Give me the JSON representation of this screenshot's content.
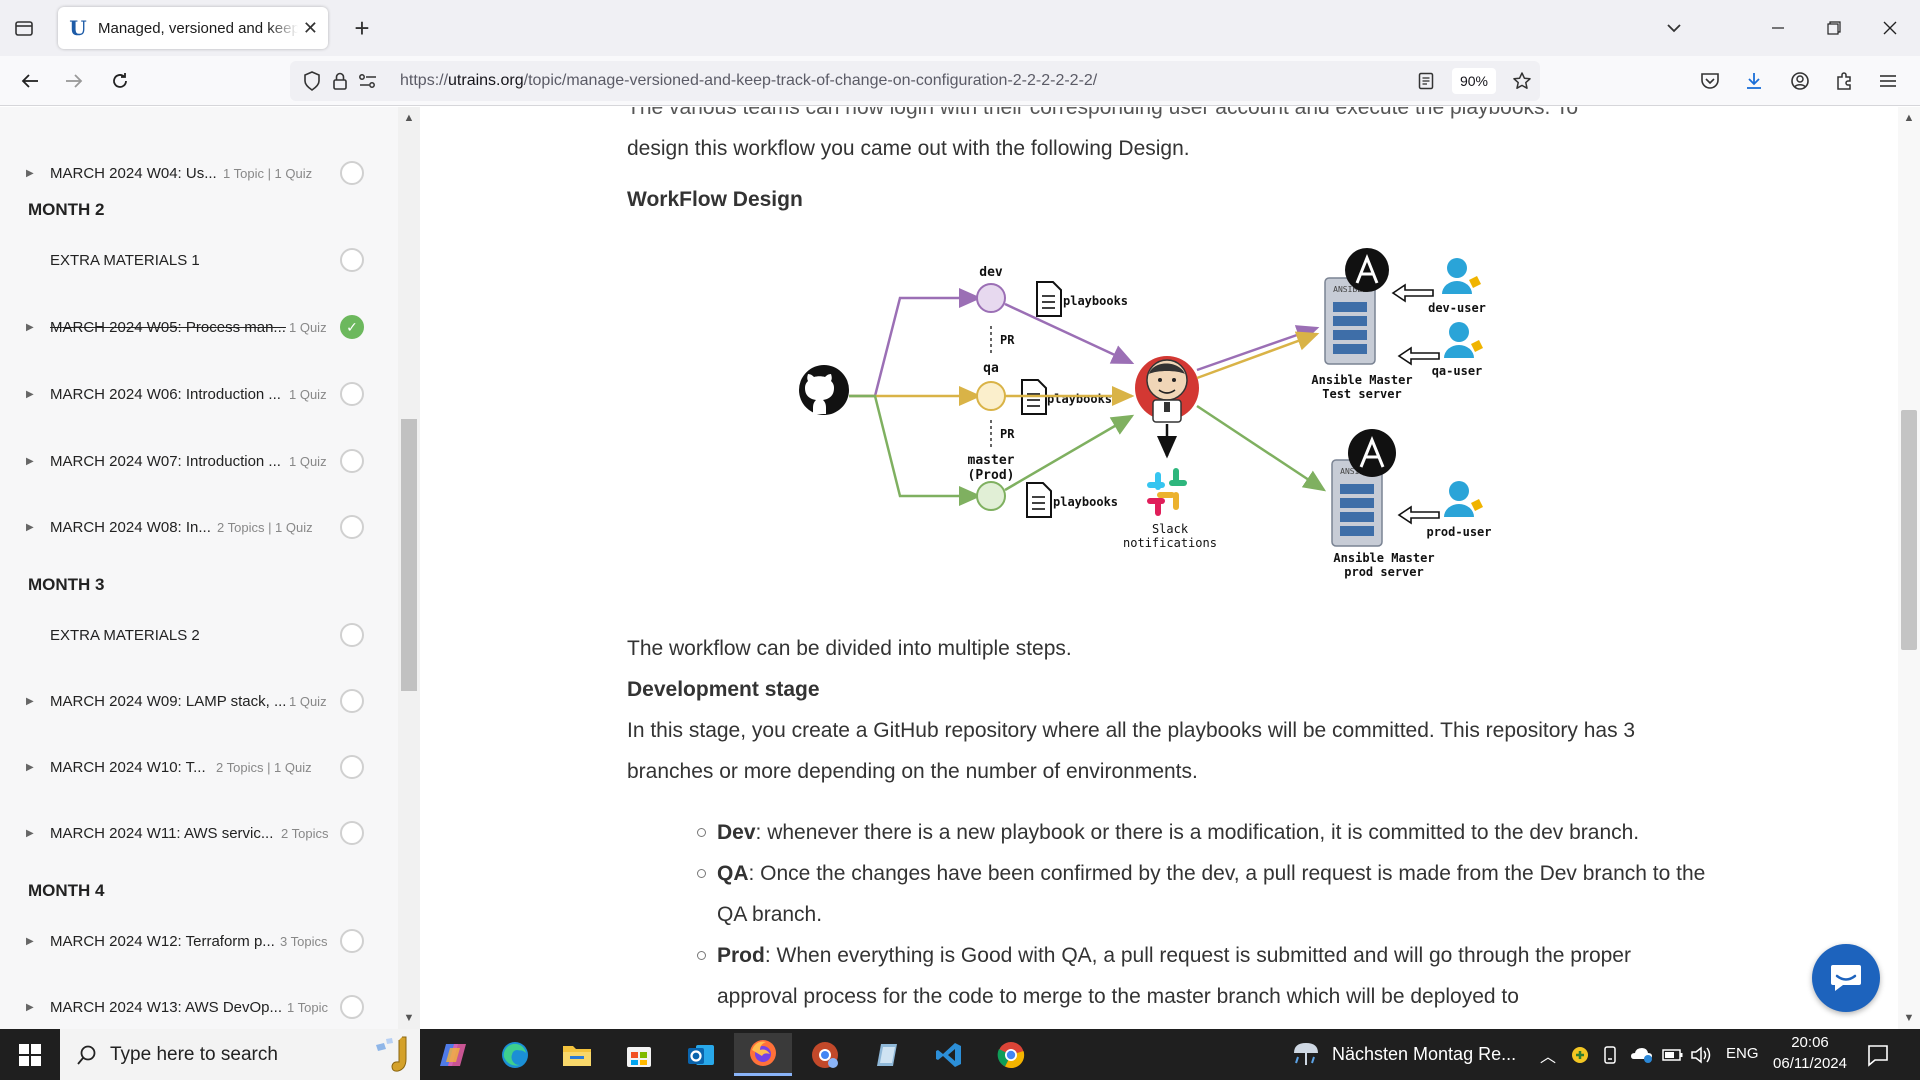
{
  "browser": {
    "tab_title": "Managed, versioned and keep track",
    "url_prefix": "https://",
    "url_domain": "utrains.org",
    "url_path": "/topic/manage-versioned-and-keep-track-of-change-on-configuration-2-2-2-2-2-2/",
    "zoom": "90%"
  },
  "sidebar": {
    "items": [
      {
        "title": "MARCH 2024 W04: Us...",
        "meta": "1 Topic  |  1 Quiz",
        "done": false
      },
      {
        "month": "MONTH 2"
      },
      {
        "title": "EXTRA MATERIALS 1",
        "meta": "",
        "done": false
      },
      {
        "title": "MARCH 2024 W05: Process man...",
        "meta": "1 Quiz",
        "done": true
      },
      {
        "title": "MARCH 2024 W06: Introduction ...",
        "meta": "1 Quiz",
        "done": false
      },
      {
        "title": "MARCH 2024 W07: Introduction ...",
        "meta": "1 Quiz",
        "done": false
      },
      {
        "title": "MARCH 2024 W08: In...",
        "meta": "2 Topics  |  1 Quiz",
        "done": false
      },
      {
        "month": "MONTH 3"
      },
      {
        "title": "EXTRA MATERIALS 2",
        "meta": "",
        "done": false
      },
      {
        "title": "MARCH 2024 W09: LAMP stack, ...",
        "meta": "1 Quiz",
        "done": false
      },
      {
        "title": "MARCH 2024 W10: T...",
        "meta": "2 Topics  |  1 Quiz",
        "done": false
      },
      {
        "title": "MARCH 2024 W11: AWS servic...",
        "meta": "2 Topics",
        "done": false
      },
      {
        "month": "MONTH 4"
      },
      {
        "title": "MARCH 2024 W12: Terraform p...",
        "meta": "3 Topics",
        "done": false
      },
      {
        "title": "MARCH 2024 W13: AWS DevOp...",
        "meta": "1 Topic",
        "done": false
      }
    ]
  },
  "content": {
    "cut_line": "The various teams can now login with their corresponding user account and execute the playbooks. To",
    "intro_line": "design this workflow you came out with the following  Design.",
    "workflow_heading": "WorkFlow Design",
    "steps_text": "The workflow can be divided into multiple steps.",
    "dev_stage_heading": "Development stage",
    "dev_stage_text": "In this stage, you create a GitHub repository where all the playbooks will be committed. This repository has 3 branches or more depending on the number of environments.",
    "bullets": [
      {
        "term": "Dev",
        "text": ": whenever there is a new playbook or there is a modification, it is committed to the dev branch."
      },
      {
        "term": "QA",
        "text": ": Once the changes have been confirmed by the dev, a pull request is made from the Dev branch to the QA branch."
      },
      {
        "term": "Prod",
        "text": ": When everything is Good with  QA, a pull request is submitted and will go through the proper approval process for the code to merge to the master branch which will be deployed to"
      }
    ]
  },
  "diagram": {
    "branch_dev": "dev",
    "branch_qa": "qa",
    "branch_master": "master",
    "branch_master_sub": "(Prod)",
    "pr": "PR",
    "playbooks": "playbooks",
    "slack_1": "Slack",
    "slack_2": "notifications",
    "test_server_1": "Ansible Master",
    "test_server_2": "Test server",
    "prod_server_1": "Ansible Master",
    "prod_server_2": "prod server",
    "dev_user": "dev-user",
    "qa_user": "qa-user",
    "prod_user": "prod-user",
    "ansible": "ANSIBLE",
    "colors": {
      "dev": "#9b6fb5",
      "qa": "#d9b347",
      "prod": "#7fb060"
    }
  },
  "taskbar": {
    "search_placeholder": "Type here to search",
    "weather": "Nächsten Montag Re...",
    "lang": "ENG",
    "time": "20:06",
    "date": "06/11/2024"
  }
}
